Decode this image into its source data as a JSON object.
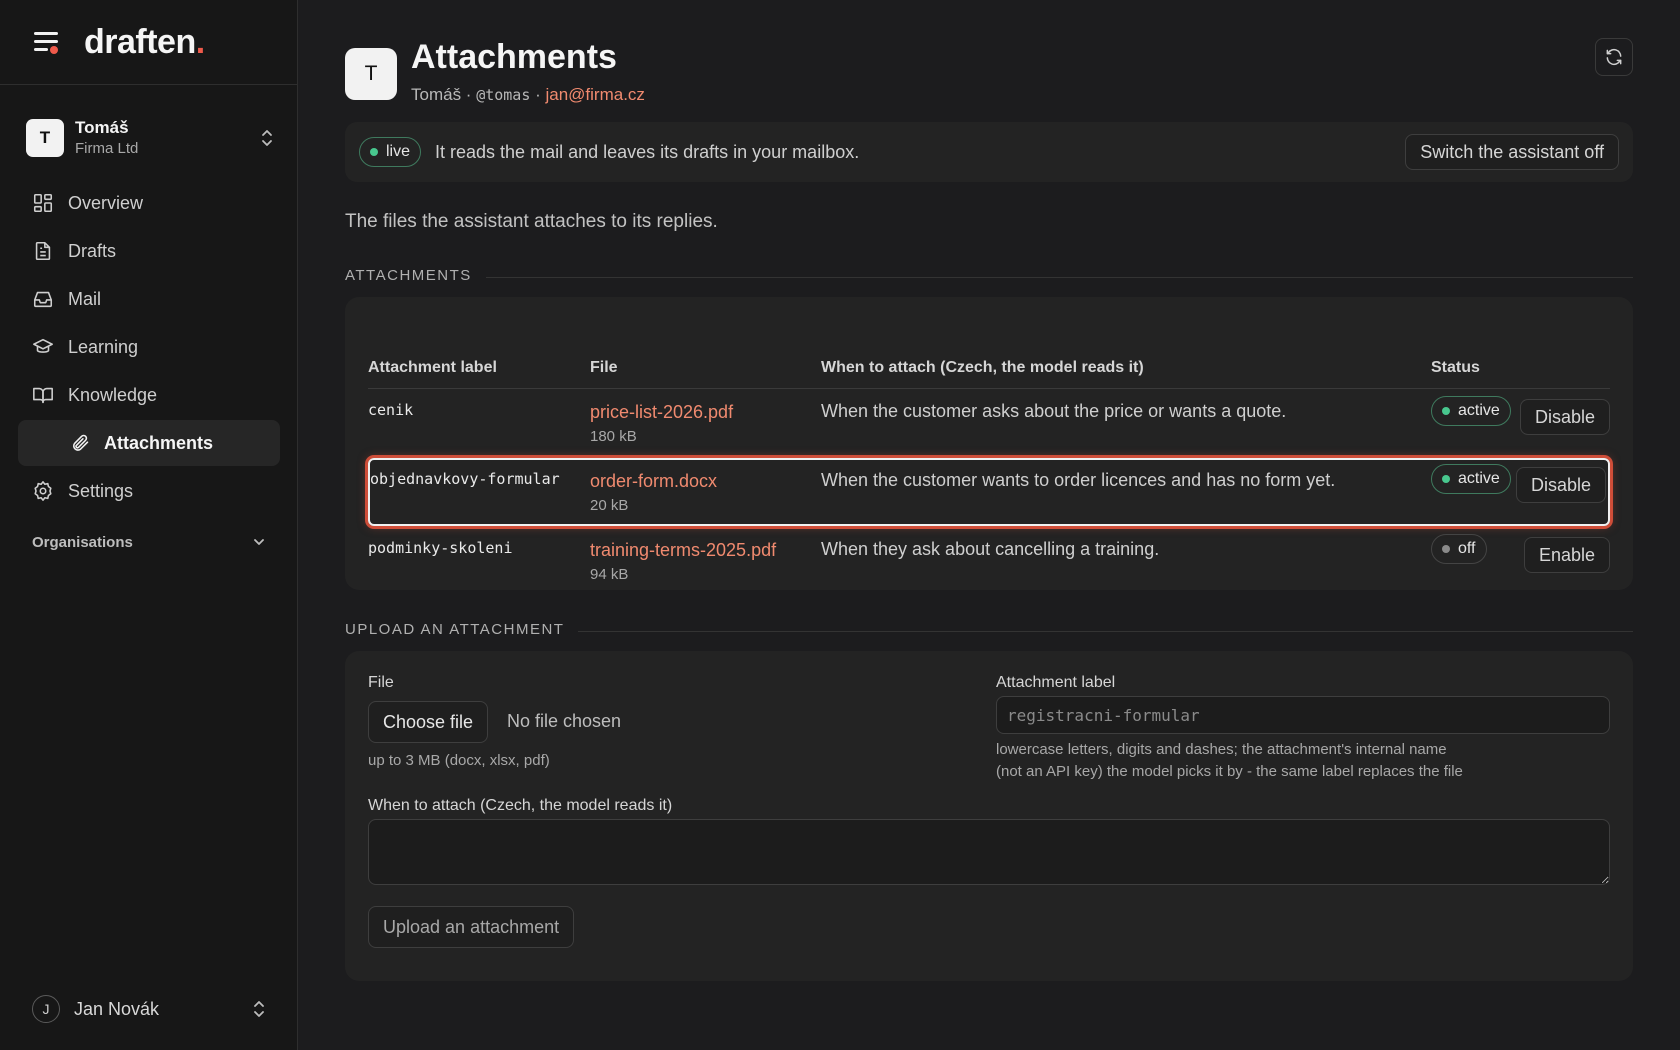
{
  "brand": {
    "name": "draften",
    "dot": "."
  },
  "org": {
    "initial": "T",
    "name": "Tomáš",
    "company": "Firma Ltd"
  },
  "nav": {
    "overview": "Overview",
    "drafts": "Drafts",
    "mail": "Mail",
    "learning": "Learning",
    "knowledge": "Knowledge",
    "attachments": "Attachments",
    "settings": "Settings"
  },
  "organisations_label": "Organisations",
  "user": {
    "initial": "J",
    "name": "Jan Novák"
  },
  "header": {
    "initial": "T",
    "title": "Attachments",
    "name": "Tomáš",
    "sep": " · ",
    "handle": "@tomas",
    "email": "jan@firma.cz"
  },
  "banner": {
    "status": "live",
    "text": "It reads the mail and leaves its drafts in your mailbox.",
    "button": "Switch the assistant off"
  },
  "intro": "The files the assistant attaches to its replies.",
  "attachments_section": "ATTACHMENTS",
  "table": {
    "headers": {
      "label": "Attachment label",
      "file": "File",
      "when": "When to attach (Czech, the model reads it)",
      "status": "Status"
    },
    "rows": [
      {
        "label": "cenik",
        "file": "price-list-2026.pdf",
        "size": "180 kB",
        "when": "When the customer asks about the price or wants a quote.",
        "status": "active",
        "action": "Disable"
      },
      {
        "label": "objednavkovy-formular",
        "file": "order-form.docx",
        "size": "20 kB",
        "when": "When the customer wants to order licences and has no form yet.",
        "status": "active",
        "action": "Disable"
      },
      {
        "label": "podminky-skoleni",
        "file": "training-terms-2025.pdf",
        "size": "94 kB",
        "when": "When they ask about cancelling a training.",
        "status": "off",
        "action": "Enable"
      }
    ]
  },
  "upload_section": "UPLOAD AN ATTACHMENT",
  "upload": {
    "file_label": "File",
    "choose_file": "Choose file",
    "no_file": "No file chosen",
    "file_hint": "up to 3 MB (docx, xlsx, pdf)",
    "label_label": "Attachment label",
    "label_placeholder": "registracni-formular",
    "label_hint_1": "lowercase letters, digits and dashes; the attachment's internal name",
    "label_hint_2": "(not an API key) the model picks it by - the same label replaces the file",
    "when_label": "When to attach (Czech, the model reads it)",
    "when_value": "",
    "submit": "Upload an attachment"
  },
  "colors": {
    "accent": "#ef5a4b",
    "link": "#f08a6f",
    "active_dot": "#48c78e",
    "bg": "#1c1c1e"
  }
}
